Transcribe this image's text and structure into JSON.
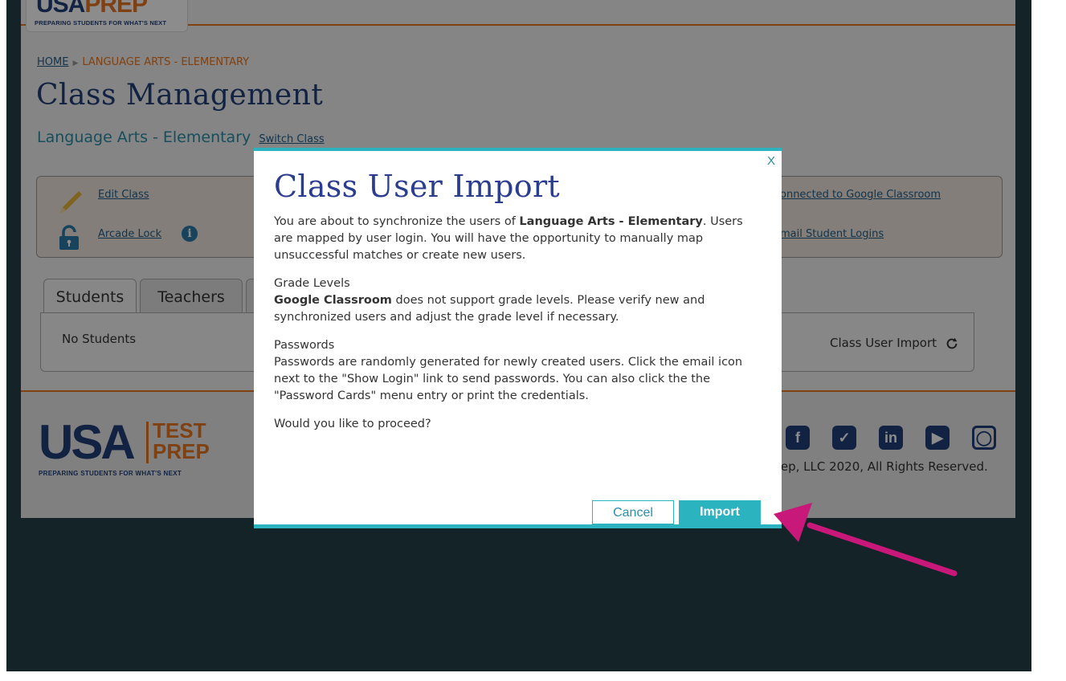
{
  "header": {
    "brand_left": "USA",
    "brand_right": "PREP",
    "tagline": "PREPARING STUDENTS FOR WHAT'S NEXT"
  },
  "breadcrumb": {
    "home": "HOME",
    "current": "LANGUAGE ARTS - ELEMENTARY"
  },
  "page": {
    "title": "Class Management",
    "class_name": "Language Arts - Elementary",
    "switch_class": "Switch Class"
  },
  "actions": {
    "edit_class": "Edit Class",
    "arcade_lock": "Arcade Lock",
    "google_classroom": "onnected to Google Classroom",
    "email_logins": "mail Student Logins"
  },
  "tabs": {
    "students": "Students",
    "teachers": "Teachers"
  },
  "panel": {
    "empty": "No Students",
    "import_link": "Class User Import"
  },
  "footer": {
    "usa": "USA",
    "test": "TEST",
    "prep": "PREP",
    "tagline": "PREPARING STUDENTS FOR WHAT'S NEXT",
    "copyright": "rep, LLC 2020, All Rights Reserved.",
    "social_icons": [
      "facebook-icon",
      "twitter-icon",
      "linkedin-icon",
      "youtube-icon",
      "instagram-icon"
    ]
  },
  "modal": {
    "close": "X",
    "title": "Class User Import",
    "intro_pre": "You are about to synchronize the users of ",
    "intro_bold": "Language Arts - Elementary",
    "intro_post": ". Users are mapped by user login. You will have the opportunity to manually map unsuccessful matches or create new users.",
    "grade_heading": "Grade Levels",
    "grade_bold": "Google Classroom",
    "grade_text": " does not support grade levels. Please verify new and synchronized users and adjust the grade level if necessary.",
    "password_heading": "Passwords",
    "password_text": "Passwords are randomly generated for newly created users. Click the email icon next to the \"Show Login\" link to send passwords. You can also click the the \"Password Cards\" menu entry or print the credentials.",
    "question": "Would you like to proceed?",
    "cancel": "Cancel",
    "import": "Import"
  },
  "colors": {
    "accent": "#2bb3c0",
    "brand_navy": "#1f3f7a",
    "brand_orange": "#e87722",
    "annotation_arrow": "#c8187a",
    "backdrop": "#254148"
  }
}
